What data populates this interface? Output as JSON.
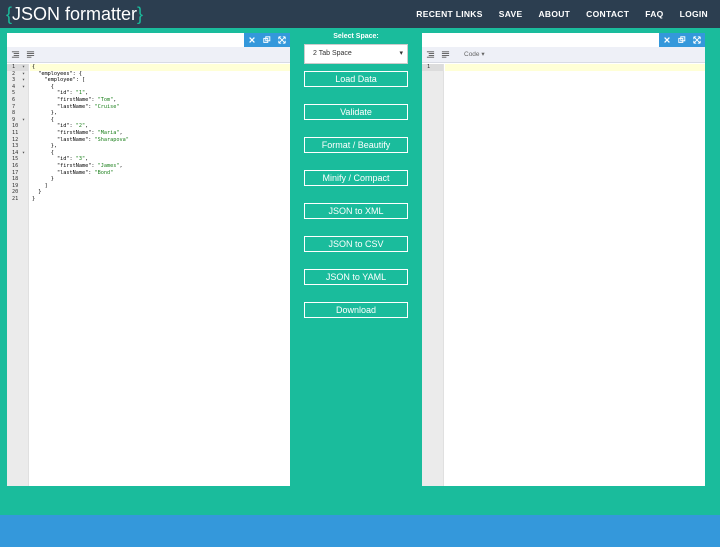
{
  "nav": {
    "brand_open": "{",
    "brand_text": "JSON formatter",
    "brand_close": "}",
    "links": [
      "RECENT LINKS",
      "SAVE",
      "ABOUT",
      "CONTACT",
      "FAQ",
      "LOGIN"
    ]
  },
  "left_editor": {
    "window_icons": [
      "close-icon",
      "copy-icon",
      "expand-icon"
    ],
    "toolbar_icons": [
      "format-icon",
      "compact-icon"
    ],
    "line_numbers": [
      "1",
      "2",
      "3",
      "4",
      "5",
      "6",
      "7",
      "8",
      "9",
      "10",
      "11",
      "12",
      "13",
      "14",
      "15",
      "16",
      "17",
      "18",
      "19",
      "20",
      "21"
    ],
    "lines": [
      "{",
      "  \"employees\": {",
      "    \"employee\": [",
      "      {",
      "        \"id\": \"1\",",
      "        \"firstName\": \"Tom\",",
      "        \"lastName\": \"Cruise\"",
      "      },",
      "      {",
      "        \"id\": \"2\",",
      "        \"firstName\": \"Maria\",",
      "        \"lastName\": \"Sharapova\"",
      "      },",
      "      {",
      "        \"id\": \"3\",",
      "        \"firstName\": \"James\",",
      "        \"lastName\": \"Bond\"",
      "      }",
      "    ]",
      "  }",
      "}"
    ]
  },
  "controls": {
    "select_label": "Select Space:",
    "select_value": "2 Tab Space",
    "buttons": [
      "Load Data",
      "Validate",
      "Format / Beautify",
      "Minify / Compact",
      "JSON to XML",
      "JSON to CSV",
      "JSON to YAML",
      "Download"
    ]
  },
  "right_editor": {
    "window_icons": [
      "close-icon",
      "copy-icon",
      "expand-icon"
    ],
    "toolbar_icons": [
      "format-icon",
      "compact-icon"
    ],
    "mode_label": "Code ▾",
    "line_numbers": [
      "1"
    ]
  },
  "colors": {
    "teal": "#1abc9c",
    "navy": "#2c3e50",
    "blue": "#3498db"
  }
}
